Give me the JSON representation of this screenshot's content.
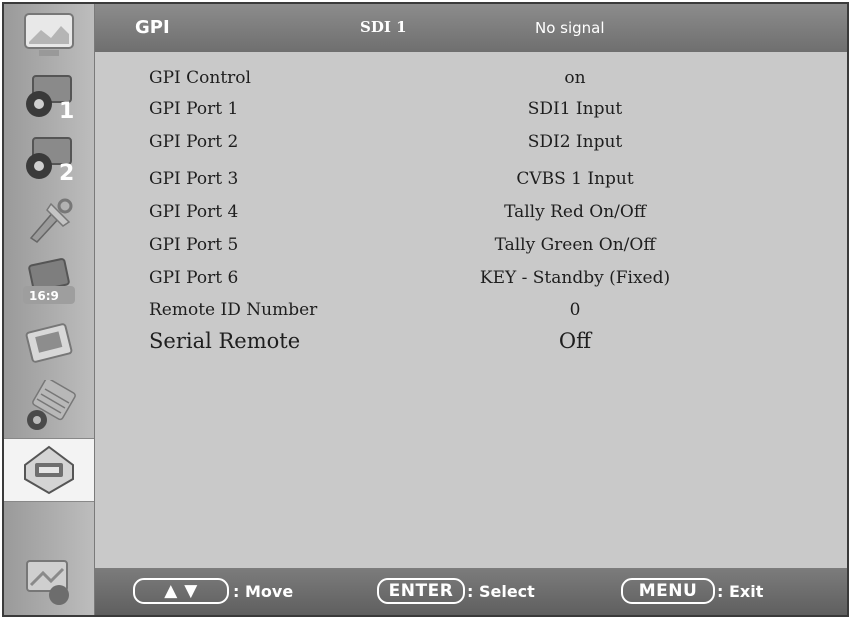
{
  "header": {
    "title": "GPI",
    "source": "SDI 1",
    "status": "No signal"
  },
  "sidebar": {
    "items": [
      {
        "icon": "picture-icon"
      },
      {
        "icon": "input-1-icon",
        "badge": "1"
      },
      {
        "icon": "input-2-icon",
        "badge": "2"
      },
      {
        "icon": "tools-icon"
      },
      {
        "icon": "aspect-ratio-icon"
      },
      {
        "icon": "marker-icon"
      },
      {
        "icon": "keyboard-icon"
      },
      {
        "icon": "gpi-icon",
        "active": true
      },
      {
        "icon": "system-icon"
      }
    ]
  },
  "menu": {
    "rows": [
      {
        "label": "GPI Control",
        "value": "on"
      },
      {
        "label": "GPI Port 1",
        "value": "SDI1 Input"
      },
      {
        "label": "GPI Port 2",
        "value": "SDI2 Input"
      },
      {
        "label": "GPI Port 3",
        "value": "CVBS 1 Input"
      },
      {
        "label": "GPI Port 4",
        "value": "Tally Red On/Off"
      },
      {
        "label": "GPI Port 5",
        "value": "Tally Green On/Off"
      },
      {
        "label": "GPI Port 6",
        "value": "KEY - Standby (Fixed)"
      },
      {
        "label": "Remote ID Number",
        "value": "0"
      },
      {
        "label": "Serial Remote",
        "value": "Off"
      }
    ]
  },
  "footer": {
    "move_key": "▲ ▼",
    "move_label": ": Move",
    "enter_key": "ENTER",
    "select_label": ": Select",
    "menu_key": "MENU",
    "exit_label": ": Exit"
  }
}
